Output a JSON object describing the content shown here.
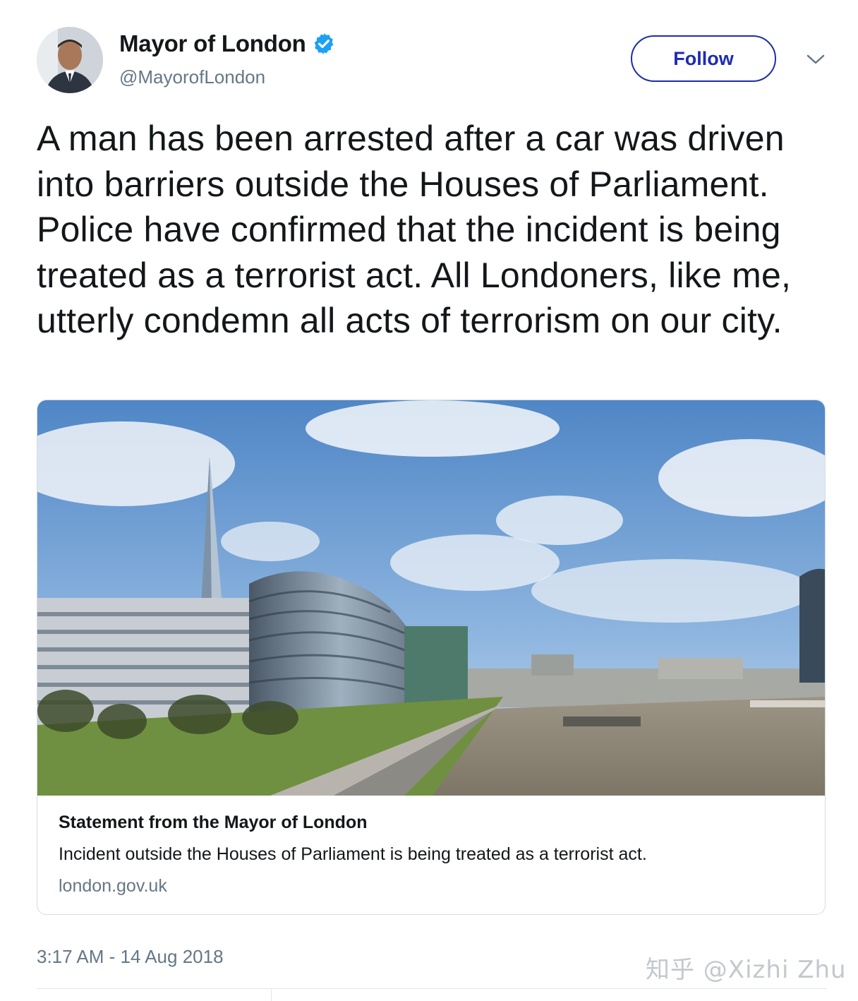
{
  "author": {
    "display_name": "Mayor of London",
    "handle": "@MayorofLondon",
    "verified": true,
    "avatar_icon": "user-avatar"
  },
  "actions": {
    "follow_label": "Follow",
    "more_icon": "chevron-down-icon"
  },
  "tweet": {
    "text": "A man has been arrested after a car was driven into barriers outside the Houses of Parliament. Police have confirmed that the incident is being treated as a terrorist act. All Londoners, like me, utterly condemn all acts of terrorism on our city.",
    "timestamp": "3:17 AM - 14 Aug 2018"
  },
  "card": {
    "title": "Statement from the Mayor of London",
    "description": "Incident outside the Houses of Parliament is being treated as a terrorist act.",
    "domain": "london.gov.uk"
  },
  "watermark": "知乎 @Xizhi Zhu",
  "colors": {
    "follow_blue": "#1d2bb4",
    "verified_blue": "#1da1f2",
    "secondary_text": "#657786"
  }
}
